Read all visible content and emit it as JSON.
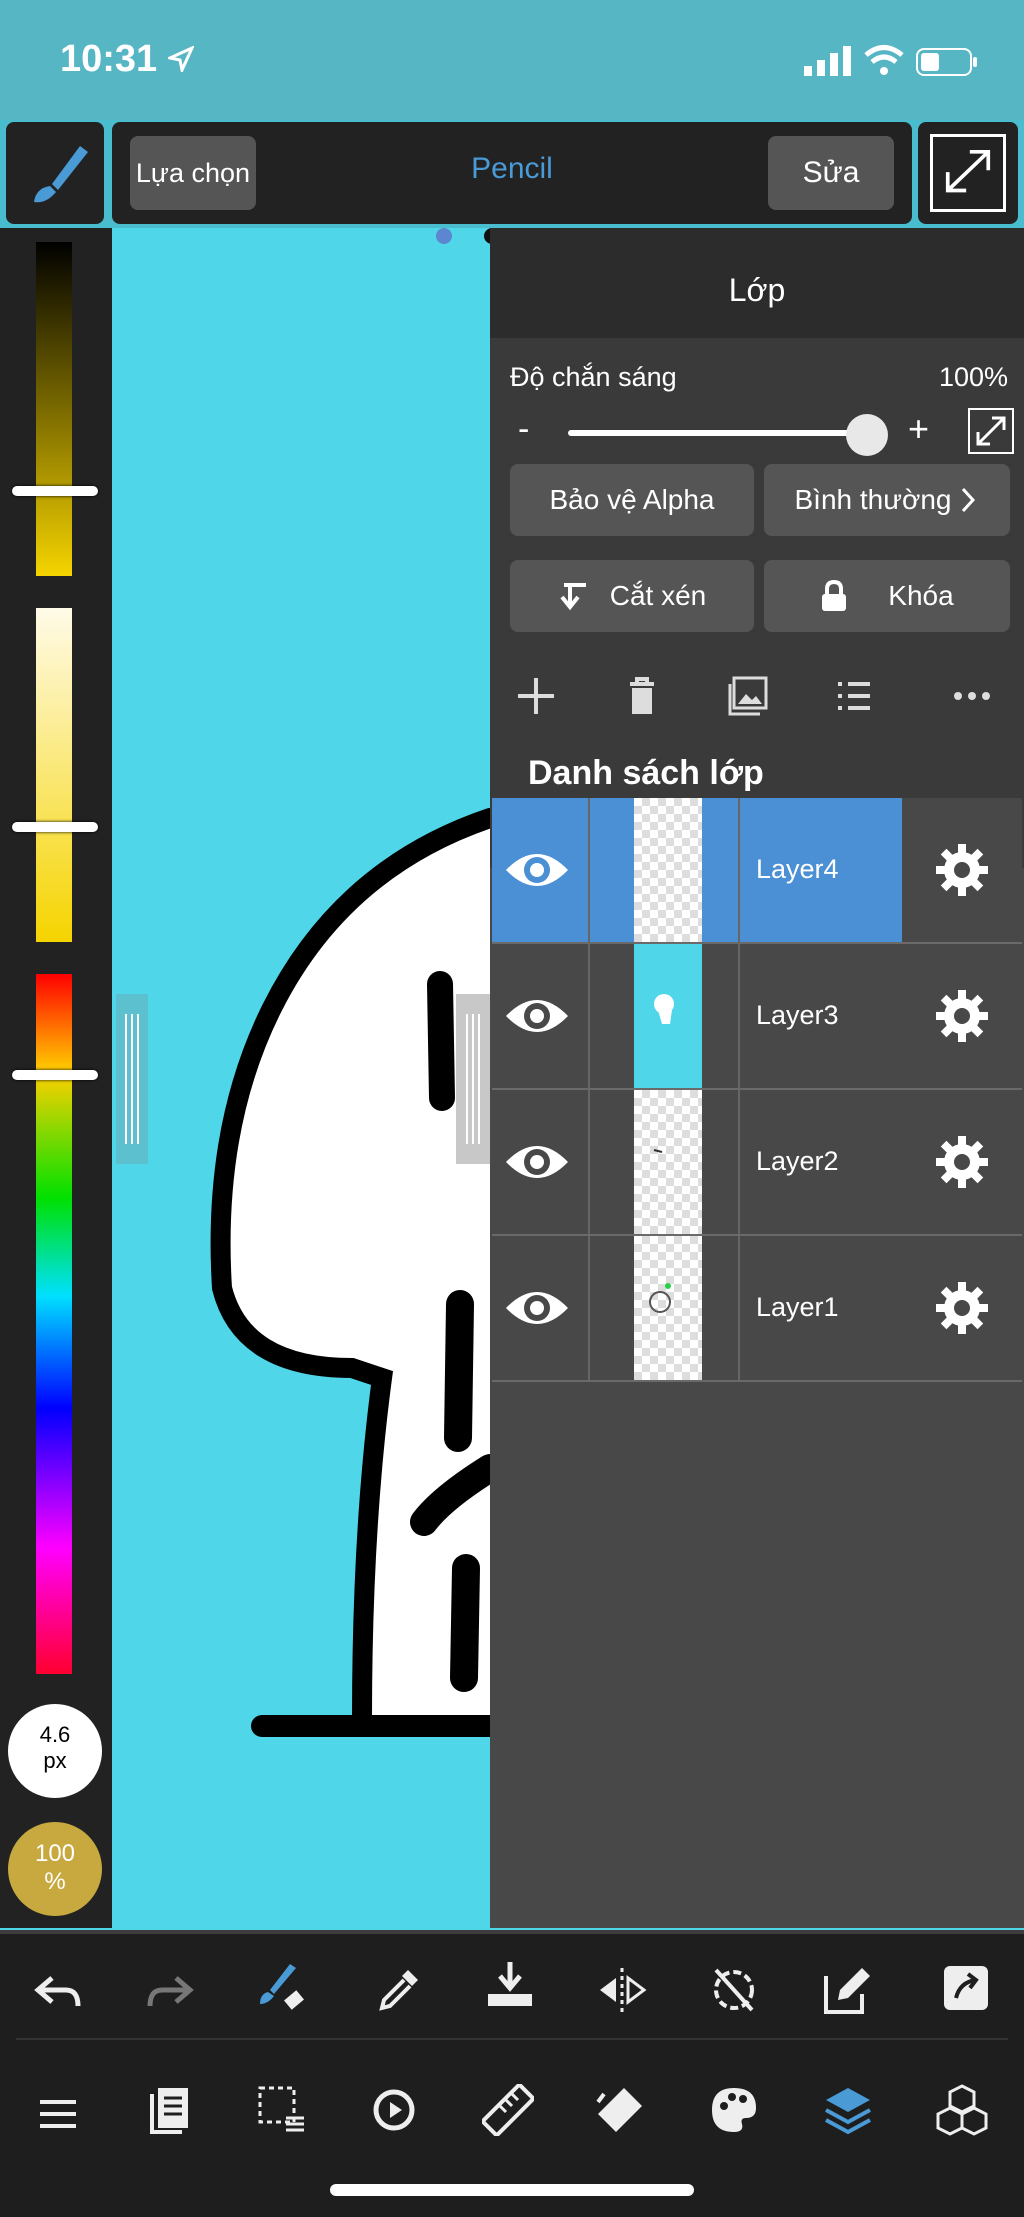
{
  "status_bar": {
    "time": "10:31"
  },
  "toolbar": {
    "select_label": "Lựa chọn",
    "tool_name": "Pencil",
    "edit_label": "Sửa"
  },
  "brush": {
    "size_value": "4.6",
    "size_unit": "px",
    "opacity_value": "100",
    "opacity_unit": "%"
  },
  "layer_panel": {
    "title": "Lớp",
    "opacity_label": "Độ chắn sáng",
    "opacity_value": "100%",
    "opacity_fraction": 1.0,
    "minus": "-",
    "plus": "+",
    "alpha_protect_label": "Bảo vệ Alpha",
    "blend_mode_label": "Bình thường",
    "clipping_label": "Cắt xén",
    "lock_label": "Khóa",
    "list_title": "Danh sách lớp",
    "layers": [
      {
        "name": "Layer4",
        "active": true
      },
      {
        "name": "Layer3",
        "active": false
      },
      {
        "name": "Layer2",
        "active": false
      },
      {
        "name": "Layer1",
        "active": false
      }
    ]
  },
  "colors": {
    "accent": "#4b8fd4",
    "canvas": "#4fd6e8",
    "panel": "#484848"
  }
}
